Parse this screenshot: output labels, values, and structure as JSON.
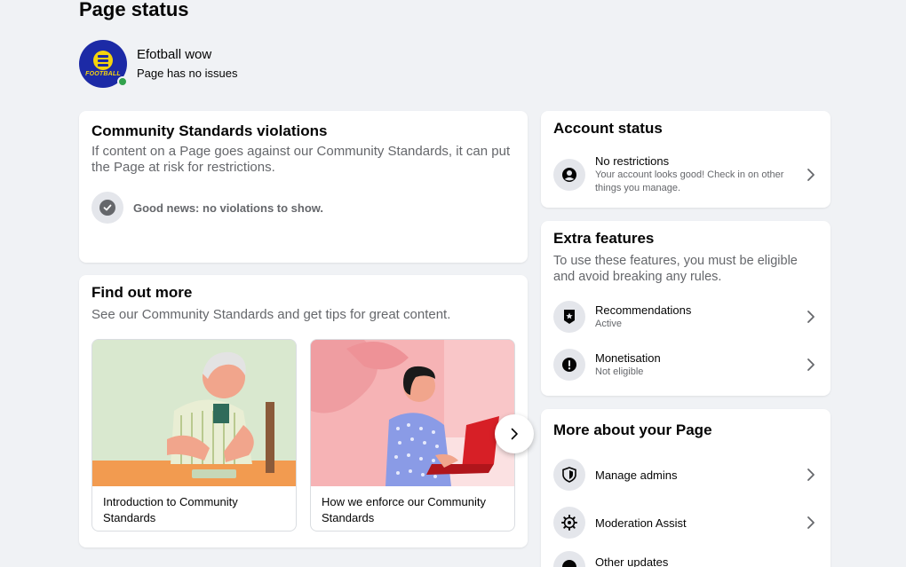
{
  "page": {
    "title": "Page status"
  },
  "profile": {
    "avatar_text": "FOOTBALL",
    "name": "Efotball wow",
    "status": "Page has no issues"
  },
  "violations": {
    "title": "Community Standards violations",
    "description": "If content on a Page goes against our Community Standards, it can put the Page at risk for restrictions.",
    "message": "Good news: no violations to show."
  },
  "find_more": {
    "title": "Find out more",
    "description": "See our Community Standards and get tips for great content.",
    "tiles": [
      {
        "caption": "Introduction to Community Standards"
      },
      {
        "caption": "How we enforce our Community Standards"
      }
    ]
  },
  "account": {
    "title": "Account status",
    "item": {
      "title": "No restrictions",
      "subtitle": "Your account looks good! Check in on other things you manage.",
      "icon": "user-circle-icon"
    }
  },
  "extra": {
    "title": "Extra features",
    "description": "To use these features, you must be eligible and avoid breaking any rules.",
    "items": [
      {
        "title": "Recommendations",
        "subtitle": "Active",
        "icon": "badge-star-icon"
      },
      {
        "title": "Monetisation",
        "subtitle": "Not eligible",
        "icon": "exclamation-icon"
      }
    ]
  },
  "more": {
    "title": "More about your Page",
    "items": [
      {
        "title": "Manage admins",
        "icon": "shield-icon"
      },
      {
        "title": "Moderation Assist",
        "icon": "gear-icon"
      },
      {
        "title": "Other updates",
        "icon": "info-icon"
      }
    ]
  },
  "colors": {
    "online": "#31a24c",
    "avatar_bg": "#1c2aa6",
    "avatar_accent": "#f5d40d"
  }
}
